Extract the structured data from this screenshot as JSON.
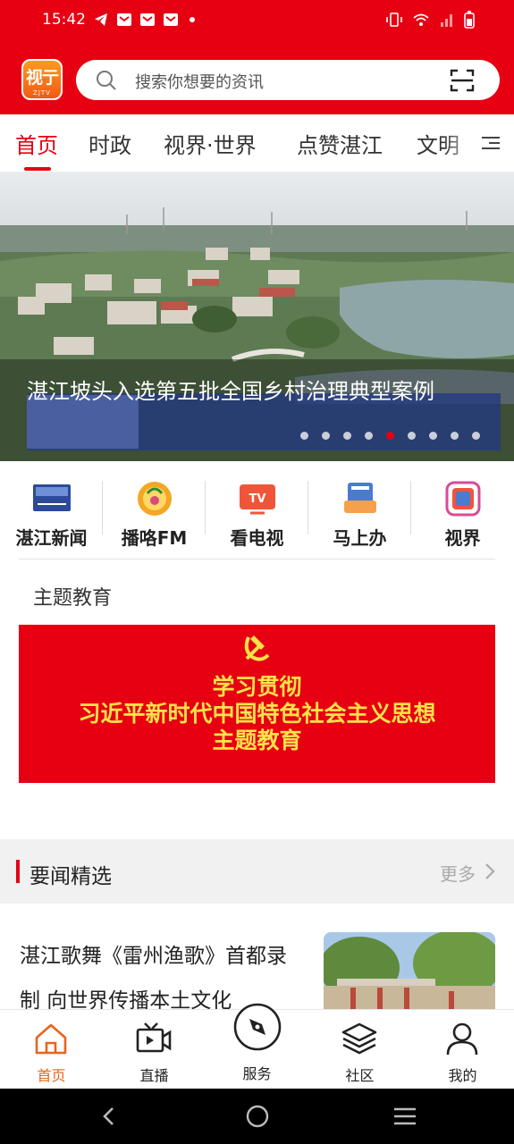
{
  "status_bar": {
    "time": "15:42"
  },
  "app": {
    "logo_text": "视亍",
    "logo_sub": "ZJTV"
  },
  "search": {
    "placeholder": "搜索你想要的资讯"
  },
  "tabs": [
    {
      "label": "首页",
      "active": true
    },
    {
      "label": "时政"
    },
    {
      "label": "视界·世界"
    },
    {
      "label": "点赞湛江"
    },
    {
      "label": "文明"
    }
  ],
  "banner": {
    "title": "湛江坡头入选第五批全国乡村治理典型案例",
    "dot_count": 9,
    "active_dot": 5
  },
  "quick_entries": [
    {
      "label": "湛江新闻",
      "icon": "zhanjiang-news-icon"
    },
    {
      "label": "播咯FM",
      "icon": "fm-radio-icon"
    },
    {
      "label": "看电视",
      "icon": "tv-icon"
    },
    {
      "label": "马上办",
      "icon": "service-desk-icon"
    },
    {
      "label": "视界",
      "icon": "shijie-icon"
    }
  ],
  "theme": {
    "title": "主题教育",
    "banner_lines": [
      "学习贯彻",
      "习近平新时代中国特色社会主义思想",
      "主题教育"
    ]
  },
  "news_section": {
    "title": "要闻精选",
    "more": "更多",
    "items": [
      {
        "text": "湛江歌舞《雷州渔歌》首都录制 向世界传播本土文化"
      }
    ]
  },
  "bottom_nav": [
    {
      "label": "首页",
      "icon": "home-icon",
      "active": true
    },
    {
      "label": "直播",
      "icon": "live-video-icon"
    },
    {
      "label": "服务",
      "icon": "compass-icon"
    },
    {
      "label": "社区",
      "icon": "layers-icon"
    },
    {
      "label": "我的",
      "icon": "user-icon"
    }
  ],
  "colors": {
    "brand_red": "#e60012",
    "nav_active": "#e8641c",
    "theme_text": "#ffe24a"
  }
}
